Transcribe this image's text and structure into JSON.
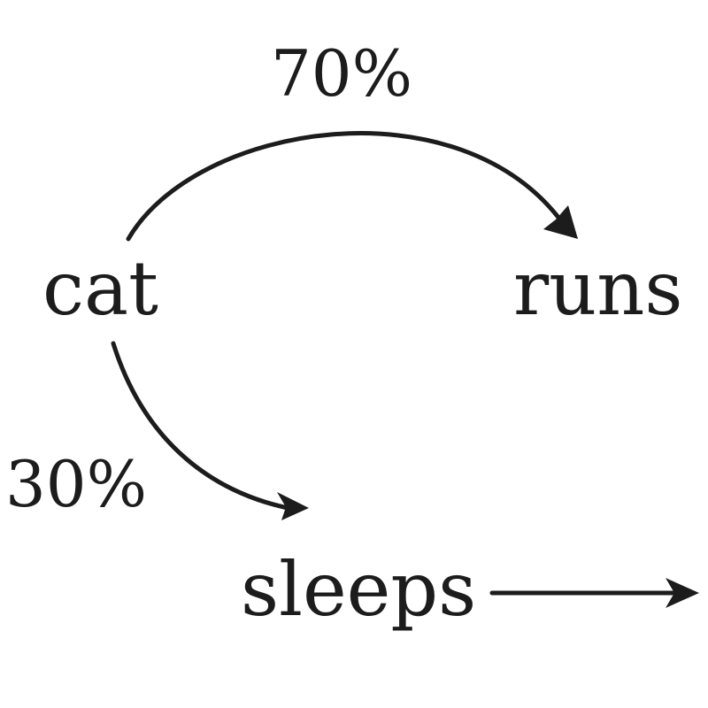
{
  "nodes": {
    "cat": "cat",
    "runs": "runs",
    "sleeps": "sleeps"
  },
  "edges": {
    "cat_to_runs": "70%",
    "cat_to_sleeps": "30%"
  },
  "colors": {
    "ink": "#1c1c1c",
    "background": "#ffffff"
  }
}
